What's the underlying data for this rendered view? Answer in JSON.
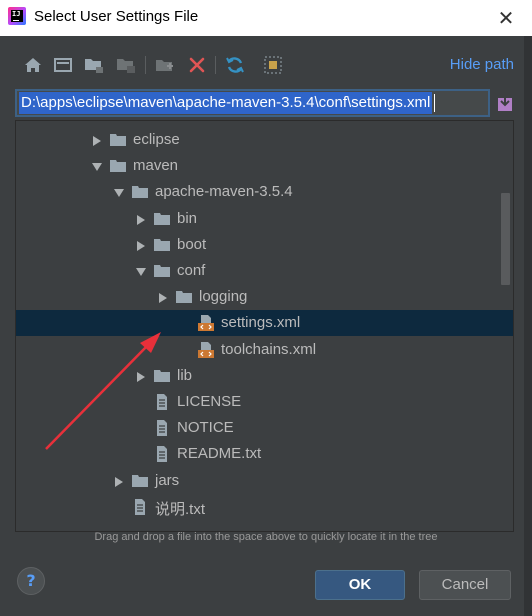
{
  "window": {
    "title": "Select User Settings File",
    "close_glyph": "✕"
  },
  "toolbar": {
    "icons": [
      "home-icon",
      "desktop-icon",
      "project-folder-icon",
      "module-folder-icon",
      "new-folder-icon",
      "delete-icon",
      "refresh-icon",
      "show-hidden-icon"
    ],
    "hide_path_label": "Hide path"
  },
  "path": {
    "value": "D:\\apps\\eclipse\\maven\\apache-maven-3.5.4\\conf\\settings.xml"
  },
  "tree": {
    "items": [
      {
        "label": "eclipse",
        "type": "folder",
        "expanded": false
      },
      {
        "label": "maven",
        "type": "folder",
        "expanded": true
      },
      {
        "label": "apache-maven-3.5.4",
        "type": "folder",
        "expanded": true
      },
      {
        "label": "bin",
        "type": "folder",
        "expanded": false
      },
      {
        "label": "boot",
        "type": "folder",
        "expanded": false
      },
      {
        "label": "conf",
        "type": "folder",
        "expanded": true
      },
      {
        "label": "logging",
        "type": "folder",
        "expanded": false
      },
      {
        "label": "settings.xml",
        "type": "xml",
        "selected": true
      },
      {
        "label": "toolchains.xml",
        "type": "xml"
      },
      {
        "label": "lib",
        "type": "folder",
        "expanded": false
      },
      {
        "label": "LICENSE",
        "type": "file"
      },
      {
        "label": "NOTICE",
        "type": "file"
      },
      {
        "label": "README.txt",
        "type": "file"
      },
      {
        "label": "jars",
        "type": "folder",
        "expanded": false
      },
      {
        "label": "说明.txt",
        "type": "file"
      }
    ]
  },
  "hint": "Drag and drop a file into the space above to quickly locate it in the tree",
  "buttons": {
    "help": "?",
    "ok": "OK",
    "cancel": "Cancel"
  },
  "colors": {
    "accent": "#589df6",
    "selection": "#0d293e",
    "path_selection": "#2f65ca",
    "xml_icon": "#cc7832",
    "annotation_arrow": "#e8303a"
  }
}
